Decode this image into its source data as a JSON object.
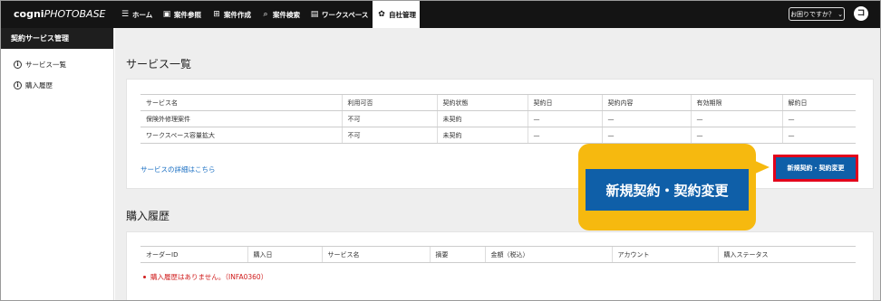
{
  "app": {
    "logo_main": "cogni",
    "logo_sub": "PHOTOBASE"
  },
  "nav": {
    "items": [
      {
        "label": "ホーム",
        "icon": "list-icon"
      },
      {
        "label": "案件参照",
        "icon": "image-icon"
      },
      {
        "label": "案件作成",
        "icon": "image-add-icon"
      },
      {
        "label": "案件検索",
        "icon": "search-icon"
      },
      {
        "label": "ワークスペース",
        "icon": "workspace-icon"
      },
      {
        "label": "自社管理",
        "icon": "gear-icon"
      }
    ],
    "active": "自社管理",
    "help_label": "お困りですか？",
    "user_initial": "コ"
  },
  "sidebar": {
    "title": "契約サービス管理",
    "items": [
      {
        "label": "サービス一覧"
      },
      {
        "label": "購入履歴"
      }
    ]
  },
  "services": {
    "title": "サービス一覧",
    "columns": [
      "サービス名",
      "利用可否",
      "契約状態",
      "契約日",
      "契約内容",
      "有効期限",
      "解約日"
    ],
    "rows": [
      [
        "保険外修理案件",
        "不可",
        "未契約",
        "—",
        "—",
        "—",
        "—"
      ],
      [
        "ワークスペース容量拡大",
        "不可",
        "未契約",
        "—",
        "—",
        "—",
        "—"
      ]
    ],
    "details_link": "サービスの詳細はこちら",
    "new_contract_button": "新規契約・契約変更"
  },
  "callout": {
    "text": "新規契約・契約変更"
  },
  "purchases": {
    "title": "購入履歴",
    "columns": [
      "オーダーID",
      "購入日",
      "サービス名",
      "摘要",
      "金額（税込）",
      "アカウント",
      "購入ステータス"
    ],
    "empty_message": "購入履歴はありません。（INFA0360）"
  },
  "colors": {
    "topbar": "#141414",
    "accent_blue": "#0f5fa8",
    "highlight_red": "#e3001b",
    "callout_yellow": "#f6b90f",
    "error_red": "#d01d1d"
  }
}
